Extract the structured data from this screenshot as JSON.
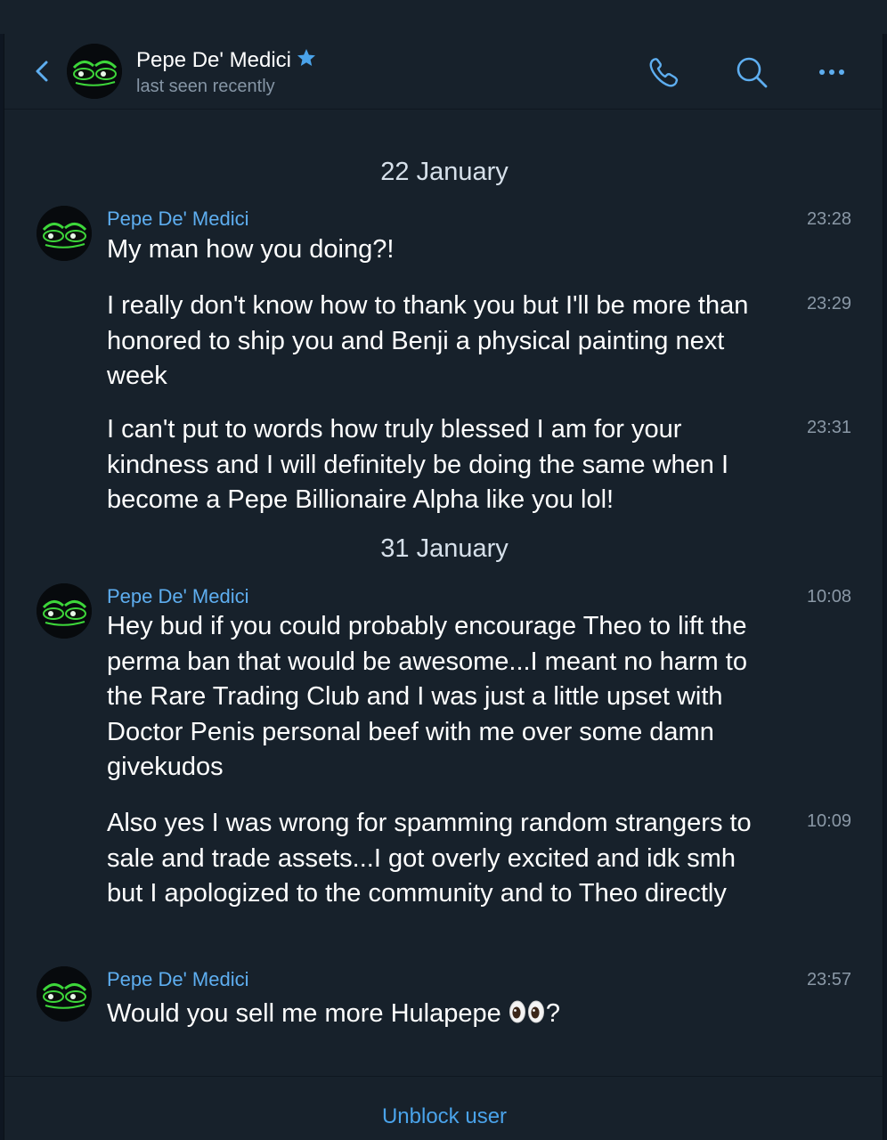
{
  "header": {
    "contact_name": "Pepe De' Medici",
    "status": "last seen recently"
  },
  "icons": {
    "back": "chevron-left-icon",
    "verified": "star-icon",
    "call": "phone-icon",
    "search": "search-icon",
    "more": "more-horizontal-icon"
  },
  "colors": {
    "accent": "#5eaef0",
    "background": "#17212b",
    "avatar_green": "#3dd63a"
  },
  "dates": [
    "22 January",
    "31 January"
  ],
  "messages": [
    {
      "sender": "Pepe De' Medici",
      "time": "23:28",
      "text": "My man how you doing?!"
    },
    {
      "time": "23:29",
      "text": "I really don't know how to thank you but I'll be more than honored to ship you and Benji a physical painting next week"
    },
    {
      "time": "23:31",
      "text": "I can't put to words how truly blessed I am for your kindness and I will definitely be doing the same when I become a Pepe Billionaire Alpha like you lol!"
    },
    {
      "sender": "Pepe De' Medici",
      "time": "10:08",
      "text": "Hey bud if you could probably encourage Theo to lift the perma ban that would be awesome...I meant no harm to the Rare Trading Club and I was just a little upset with Doctor Penis personal beef with me over some damn givekudos"
    },
    {
      "time": "10:09",
      "text": "Also yes I was wrong for spamming random strangers to sale and trade assets...I got overly excited and idk smh but I apologized to the community and to Theo directly"
    },
    {
      "sender": "Pepe De' Medici",
      "time": "23:57",
      "text": "Would you sell me more Hulapepe",
      "text_suffix": "?"
    }
  ],
  "footer": {
    "unblock_label": "Unblock user"
  }
}
